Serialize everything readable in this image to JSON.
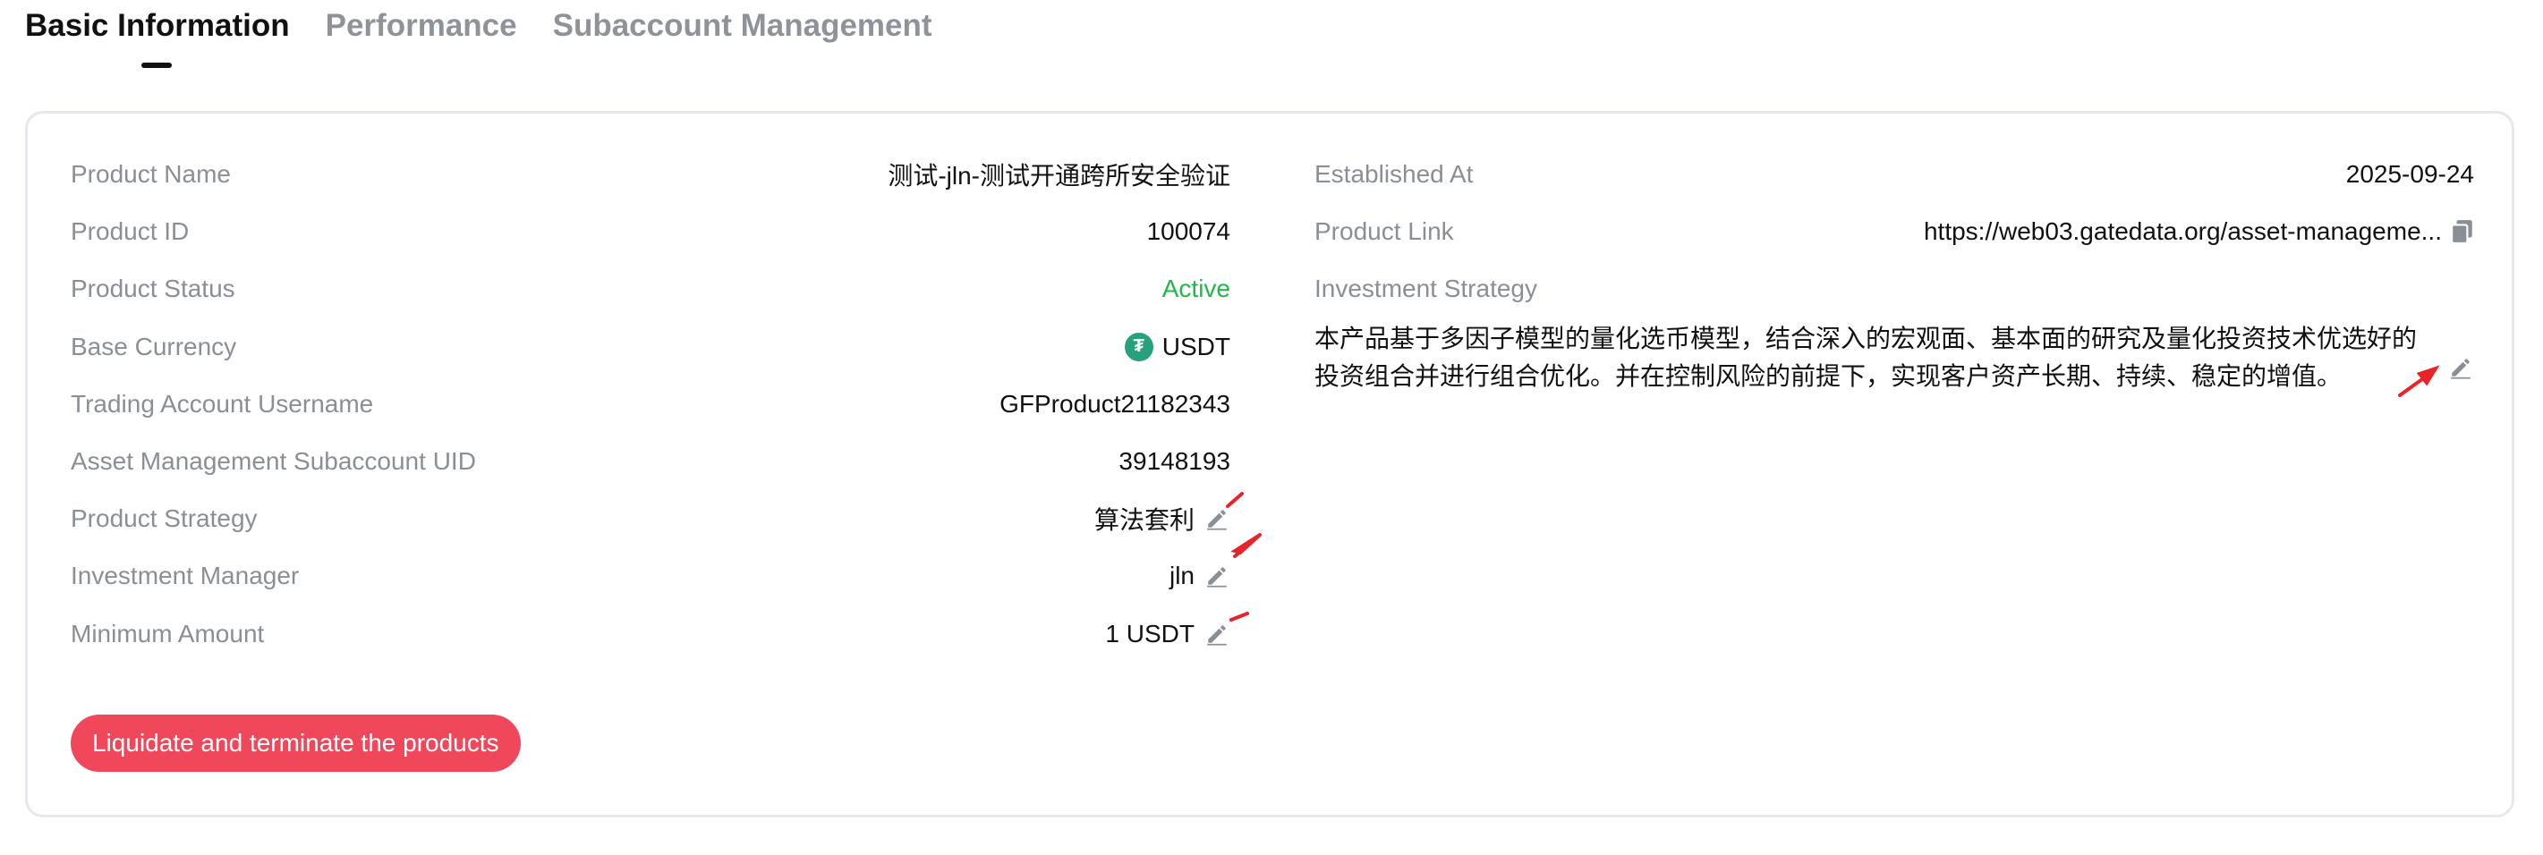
{
  "tabs": [
    {
      "label": "Basic Information",
      "active": true
    },
    {
      "label": "Performance",
      "active": false
    },
    {
      "label": "Subaccount Management",
      "active": false
    }
  ],
  "left": {
    "product_name": {
      "label": "Product Name",
      "value": "测试-jln-测试开通跨所安全验证"
    },
    "product_id": {
      "label": "Product ID",
      "value": "100074"
    },
    "product_status": {
      "label": "Product Status",
      "value": "Active"
    },
    "base_currency": {
      "label": "Base Currency",
      "value": "USDT",
      "icon": "usdt-coin-icon"
    },
    "trading_account": {
      "label": "Trading Account Username",
      "value": "GFProduct21182343"
    },
    "subaccount_uid": {
      "label": "Asset Management Subaccount UID",
      "value": "39148193"
    },
    "product_strategy": {
      "label": "Product Strategy",
      "value": "算法套利"
    },
    "investment_manager": {
      "label": "Investment Manager",
      "value": "jln"
    },
    "minimum_amount": {
      "label": "Minimum Amount",
      "value": "1 USDT"
    }
  },
  "right": {
    "established_at": {
      "label": "Established At",
      "value": "2025-09-24"
    },
    "product_link": {
      "label": "Product Link",
      "value": "https://web03.gatedata.org/asset-manageme..."
    },
    "investment_strategy": {
      "label": "Investment Strategy",
      "value": "本产品基于多因子模型的量化选币模型，结合深入的宏观面、基本面的研究及量化投资技术优选好的投资组合并进行组合优化。并在控制风险的前提下，实现客户资产长期、持续、稳定的增值。"
    }
  },
  "actions": {
    "terminate_label": "Liquidate and terminate the products"
  },
  "colors": {
    "active_status": "#21b84b",
    "danger_button": "#f0485a",
    "annotation_arrow": "#e8242a"
  }
}
